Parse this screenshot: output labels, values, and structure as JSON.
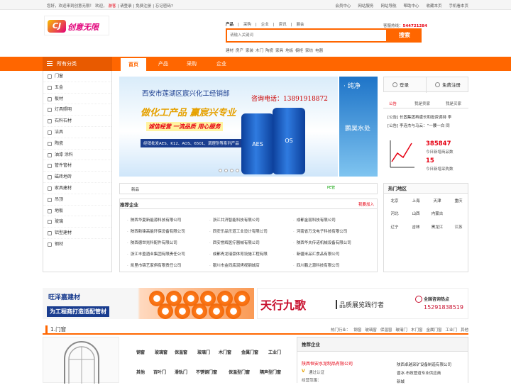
{
  "topbar": {
    "left": [
      "您好，欢迎来到创意无限！",
      "欢迎，",
      "游客",
      "| 请登录",
      "| 免费注册",
      "| 忘记密码?"
    ],
    "right": [
      "会员中心",
      "网站服务",
      "网站导航",
      "帮助中心",
      "收藏本页",
      "手机看本页"
    ]
  },
  "logo": {
    "badge": "CJ",
    "text": "创意无限"
  },
  "search": {
    "tabs": [
      "产品",
      "|",
      "采购",
      "|",
      "企业",
      "|",
      "资讯",
      "|",
      "展会"
    ],
    "placeholder": "请输入关键词",
    "button": "搜索",
    "hotline_label": "客服热线：",
    "hotline": "544721284",
    "hot_words": [
      "建材",
      "房产",
      "家装",
      "木门",
      "陶瓷",
      "家具",
      "地板",
      "橱柜",
      "家纺",
      "电器"
    ]
  },
  "nav": {
    "category_label": "所有分类",
    "items": [
      "首页",
      "产品",
      "采购",
      "企业"
    ]
  },
  "sidebar": {
    "items": [
      "门窗",
      "五金",
      "板材",
      "灯具照明",
      "石料石材",
      "洁具",
      "陶瓷",
      "油漆 涂料",
      "管件管材",
      "磁砖地砖",
      "家具建材",
      "吊顶",
      "地板",
      "玻璃",
      "铝型建材",
      "钢材"
    ]
  },
  "banner": {
    "title": "西安市莲湖区宸兴化工经销部",
    "phone": "咨询电话：13891918872",
    "slogan": "做化工产品 赢宸兴专业",
    "subslogan": "诚信经营 一流品质 用心服务",
    "products": "经销批发AES、K12、AOS、6501、调理剂等系列产品",
    "drum1": "AES",
    "drum2": "OS"
  },
  "banner2": {
    "top": "· 纯净",
    "mid": "鹏昊水处"
  },
  "news": {
    "label": "新品",
    "tag": "PE管"
  },
  "recommend": {
    "title": "推荐企业",
    "join": "我要加入",
    "companies": [
      [
        "陕西华夏新能源科技有限公司",
        "浙江共济智能科技有限公司",
        "成都金丽科技有限公司"
      ],
      [
        "陕西新锋高能环保设备有限公司",
        "西安乐品乐道工业设计有限公司",
        "河南省万戈电子科技有限公司"
      ],
      [
        "陕西德世兆科配件有限公司",
        "西安誉辉医疗器械有限公司",
        "陕西华夫传诺机械设备有限公司"
      ],
      [
        "浙江丰盈酒业集团有限责任公司",
        "成都青龙瑞豪体育设施工程有限",
        "新疆米品汇食品有限公司"
      ],
      [
        "凯里市锦艺家俱有限责任公司",
        "银川市金同底润烤视钢城店",
        "四川鹏之源科技有限公司"
      ]
    ]
  },
  "account": {
    "login": "登录",
    "register": "免费注册"
  },
  "notice_tabs": [
    "公告",
    "我是卖家",
    "我是买家"
  ],
  "notices": [
    "[公告] 长固集团再遭长和投资调持 李",
    "[公告] 李连杰与马云：“一腰一白 同"
  ],
  "stats": [
    {
      "value": "385847",
      "label": "今日新增商品数"
    },
    {
      "value": "15",
      "label": "今日新增采购数"
    }
  ],
  "hot_areas": {
    "title": "热门地区",
    "rows": [
      [
        "北京",
        "上海",
        "天津",
        "重庆"
      ],
      [
        "河北",
        "山西",
        "内蒙古",
        ""
      ],
      [
        "辽宁",
        "吉林",
        "黑龙江",
        "江苏"
      ]
    ]
  },
  "ad1": {
    "brand": "旺泽嘉建材",
    "slogan": "为工程商打造适配管材"
  },
  "ad2": {
    "title": "天行九歌",
    "subtitle": "品质展览践行者",
    "hot": "全国咨询热点",
    "phone": "15291838519"
  },
  "section": {
    "title": "1.门窗",
    "links": [
      "热门行业：",
      "钢窗",
      "玻璃窗",
      "保温窗",
      "玻璃门",
      "木门窗",
      "金属门窗",
      "工业门",
      "其他"
    ]
  },
  "product_keywords": [
    [
      "钢窗",
      "玻璃窗",
      "保温窗",
      "玻璃门",
      "木门窗",
      "金属门窗",
      "工业门"
    ],
    [
      "其他",
      "百叶门",
      "滑轨门",
      "不锈钢门窗",
      "保温型门窗",
      "隔声型门窗"
    ]
  ],
  "recent": {
    "title": "推荐企业",
    "company": "陕西恒安水泥制品有限公司",
    "badge": "V",
    "cert": "通过认证",
    "list": [
      "陕西卓越采矿设备制造有限公司",
      "晋冰·市政管道专业供应商",
      "新城"
    ],
    "more": "经营范围："
  }
}
